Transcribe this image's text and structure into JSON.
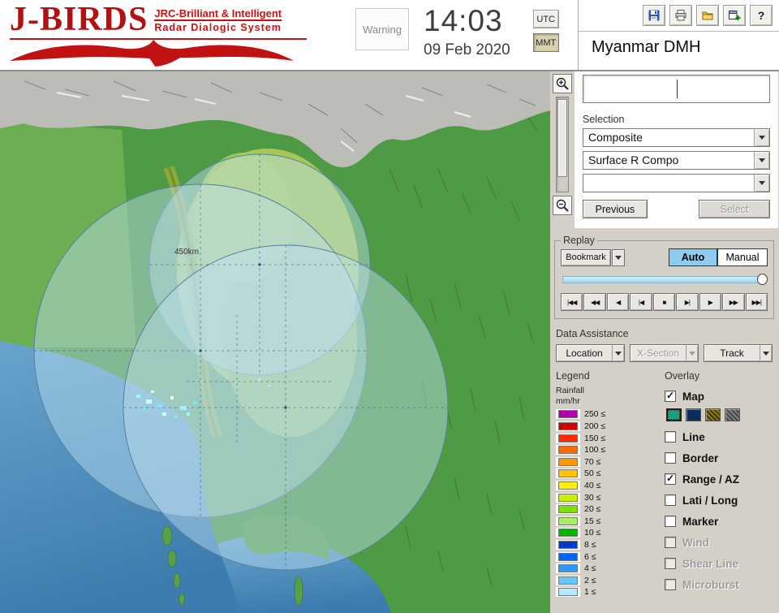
{
  "header": {
    "logo": {
      "title": "J-BIRDS",
      "tagline1": "JRC-Brilliant & Intelligent",
      "tagline2": "Radar  Dialogic  System"
    },
    "warning_label": "Warning",
    "clock": {
      "time": "14:03",
      "date": "09 Feb 2020"
    },
    "timezone": {
      "utc_label": "UTC",
      "mmt_label": "MMT",
      "selected": "MMT"
    },
    "toolbar_icons": [
      "save",
      "print",
      "open",
      "export",
      "help"
    ],
    "help_glyph": "?",
    "station_name": "Myanmar DMH"
  },
  "map": {
    "range_ring_label": "450km"
  },
  "sidebar": {
    "selection": {
      "label": "Selection",
      "composite_value": "Composite",
      "product_value": "Surface R Compo",
      "extra_value": "",
      "previous_label": "Previous",
      "select_label": "Select"
    },
    "replay": {
      "label": "Replay",
      "bookmark_label": "Bookmark",
      "auto_label": "Auto",
      "manual_label": "Manual",
      "playback_buttons": [
        {
          "name": "jump-start",
          "glyph": "|◀◀"
        },
        {
          "name": "fast-rewind",
          "glyph": "◀◀"
        },
        {
          "name": "play-reverse",
          "glyph": "◀"
        },
        {
          "name": "step-back",
          "glyph": "|◀"
        },
        {
          "name": "stop",
          "glyph": "■"
        },
        {
          "name": "step-forward",
          "glyph": "▶|"
        },
        {
          "name": "play",
          "glyph": "▶"
        },
        {
          "name": "fast-forward",
          "glyph": "▶▶"
        },
        {
          "name": "jump-end",
          "glyph": "▶▶|"
        }
      ]
    },
    "data_assistance": {
      "label": "Data Assistance",
      "buttons": [
        {
          "label": "Location",
          "disabled": false
        },
        {
          "label": "X-Section",
          "disabled": true
        },
        {
          "label": "Track",
          "disabled": false
        }
      ]
    },
    "legend": {
      "label": "Legend",
      "unit_line1": "Rainfall",
      "unit_line2": "mm/hr",
      "rows": [
        {
          "value": "250 ≤",
          "color": "#b000b0"
        },
        {
          "value": "200 ≤",
          "color": "#d00000"
        },
        {
          "value": "150 ≤",
          "color": "#ff2a00"
        },
        {
          "value": "100 ≤",
          "color": "#ff6a00"
        },
        {
          "value": "70 ≤",
          "color": "#ff9800"
        },
        {
          "value": "50 ≤",
          "color": "#ffc400"
        },
        {
          "value": "40 ≤",
          "color": "#ffee00"
        },
        {
          "value": "30 ≤",
          "color": "#c8f000"
        },
        {
          "value": "20 ≤",
          "color": "#7ce000"
        },
        {
          "value": "15 ≤",
          "color": "#a8f060"
        },
        {
          "value": "10 ≤",
          "color": "#00b400"
        },
        {
          "value": "8 ≤",
          "color": "#0038d0"
        },
        {
          "value": "6 ≤",
          "color": "#0064ff"
        },
        {
          "value": "4 ≤",
          "color": "#2e96ff"
        },
        {
          "value": "2 ≤",
          "color": "#64c8ff"
        },
        {
          "value": "1 ≤",
          "color": "#b4ecff"
        }
      ]
    },
    "overlay": {
      "label": "Overlay",
      "map_item": {
        "label": "Map",
        "check_glyph": "✓"
      },
      "style_swatches": [
        {
          "name": "terrain-green",
          "color": "#1e9e78",
          "selected": true
        },
        {
          "name": "dark-blue",
          "color": "#0c2c5c",
          "selected": false
        },
        {
          "name": "olive",
          "color": "#8a7c16",
          "selected": false
        },
        {
          "name": "dark-gray",
          "color": "#4a4a4a",
          "selected": false
        }
      ],
      "items": [
        {
          "label": "Line",
          "check_glyph": "",
          "disabled": false
        },
        {
          "label": "Border",
          "check_glyph": "",
          "disabled": false
        },
        {
          "label": "Range / AZ",
          "check_glyph": "✓",
          "disabled": false
        },
        {
          "label": "Lati / Long",
          "check_glyph": "",
          "disabled": false
        },
        {
          "label": "Marker",
          "check_glyph": "",
          "disabled": false
        },
        {
          "label": "Wind",
          "check_glyph": "",
          "disabled": true
        },
        {
          "label": "Shear Line",
          "check_glyph": "",
          "disabled": true
        },
        {
          "label": "Microburst",
          "check_glyph": "",
          "disabled": true
        }
      ]
    }
  }
}
